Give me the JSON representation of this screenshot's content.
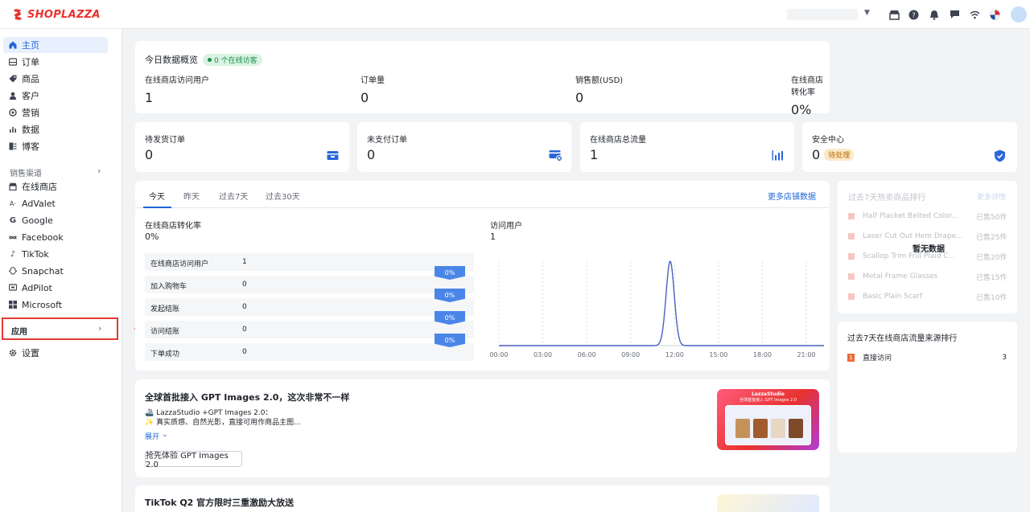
{
  "brand": {
    "name": "SHOPLAZZA",
    "color": "#e8322f"
  },
  "topbar": {
    "icons": [
      "store-icon",
      "help-icon",
      "bell-icon",
      "message-icon",
      "wifi-icon",
      "language-flag-icon"
    ]
  },
  "sidebar": {
    "items": [
      {
        "label": "主页",
        "icon": "home-icon"
      },
      {
        "label": "订单",
        "icon": "order-icon"
      },
      {
        "label": "商品",
        "icon": "tag-icon"
      },
      {
        "label": "客户",
        "icon": "person-icon"
      },
      {
        "label": "营销",
        "icon": "marketing-icon"
      },
      {
        "label": "数据",
        "icon": "bar-chart-icon"
      },
      {
        "label": "博客",
        "icon": "blog-icon"
      }
    ],
    "channels_label": "销售渠道",
    "channels": [
      {
        "label": "在线商店",
        "icon": "store-icon"
      },
      {
        "label": "AdValet",
        "icon": "advalet-icon"
      },
      {
        "label": "Google",
        "icon": "google-icon"
      },
      {
        "label": "Facebook",
        "icon": "meta-icon"
      },
      {
        "label": "TikTok",
        "icon": "tiktok-icon"
      },
      {
        "label": "Snapchat",
        "icon": "snapchat-icon"
      },
      {
        "label": "AdPilot",
        "icon": "adpilot-icon"
      },
      {
        "label": "Microsoft",
        "icon": "microsoft-icon"
      }
    ],
    "apps_label": "应用",
    "settings_label": "设置"
  },
  "overview": {
    "title": "今日数据概览",
    "online_badge": "0 个在线访客",
    "metrics": [
      {
        "label": "在线商店访问用户",
        "value": "1"
      },
      {
        "label": "订单量",
        "value": "0"
      },
      {
        "label": "销售额(USD)",
        "value": "0"
      },
      {
        "label": "在线商店转化率",
        "value": "0%"
      }
    ]
  },
  "stat_cards": [
    {
      "label": "待发货订单",
      "value": "0",
      "icon": "shipping-box-icon"
    },
    {
      "label": "未支付订单",
      "value": "0",
      "icon": "unpaid-card-icon"
    },
    {
      "label": "在线商店总流量",
      "value": "1",
      "icon": "traffic-bars-icon"
    },
    {
      "label": "安全中心",
      "value": "0",
      "badge": "待处理",
      "icon": "shield-check-icon"
    }
  ],
  "analytics": {
    "tabs": [
      "今天",
      "昨天",
      "过去7天",
      "过去30天"
    ],
    "more_link": "更多店铺数据",
    "conversion_label": "在线商店转化率",
    "conversion_value": "0%",
    "funnel": [
      {
        "label": "在线商店访问用户",
        "value": "1"
      },
      {
        "label": "加入购物车",
        "value": "0"
      },
      {
        "label": "发起结账",
        "value": "0"
      },
      {
        "label": "访问结账",
        "value": "0"
      },
      {
        "label": "下单成功",
        "value": "0"
      }
    ],
    "funnel_pcts": [
      "0%",
      "0%",
      "0%",
      "0%"
    ],
    "visitors_label": "访问用户",
    "visitors_value": "1"
  },
  "chart_data": {
    "type": "line",
    "x": [
      "00:00",
      "03:00",
      "06:00",
      "09:00",
      "12:00",
      "15:00",
      "18:00",
      "21:00"
    ],
    "peak_time": "11:00",
    "peak_value": 1,
    "color": "#4a5fc1"
  },
  "hot_products": {
    "title": "过去7天热卖商品排行",
    "more": "更多详情",
    "empty": "暂无数据",
    "items": [
      {
        "name": "Half Placket Belted Color...",
        "sold": "已售50件"
      },
      {
        "name": "Laser Cut Out Hem Drape...",
        "sold": "已售25件"
      },
      {
        "name": "Scallop Trim Frill Plaid C...",
        "sold": "已售20件"
      },
      {
        "name": "Metal Frame Glasses",
        "sold": "已售15件"
      },
      {
        "name": "Basic Plain Scarf",
        "sold": "已售10件"
      }
    ]
  },
  "traffic_sources": {
    "title": "过去7天在线商店流量来源排行",
    "items": [
      {
        "rank": "1",
        "label": "直接访问",
        "value": "3"
      }
    ]
  },
  "promo": {
    "title": "全球首批接入 GPT Images 2.0，这次非常不一样",
    "line1": "🚢 LazzaStudio +GPT Images 2.0：",
    "line2": "✨ 真实质感、自然光影，直接可用作商品主图...",
    "expand": "展开",
    "cta": "抢先体验 GPT Images 2.0",
    "banner_brand": "LazzaStudio",
    "banner_sub": "全球首批接入 GPT Images 2.0"
  },
  "promo2": {
    "title": "TikTok Q2 官方限时三重激励大放送"
  }
}
